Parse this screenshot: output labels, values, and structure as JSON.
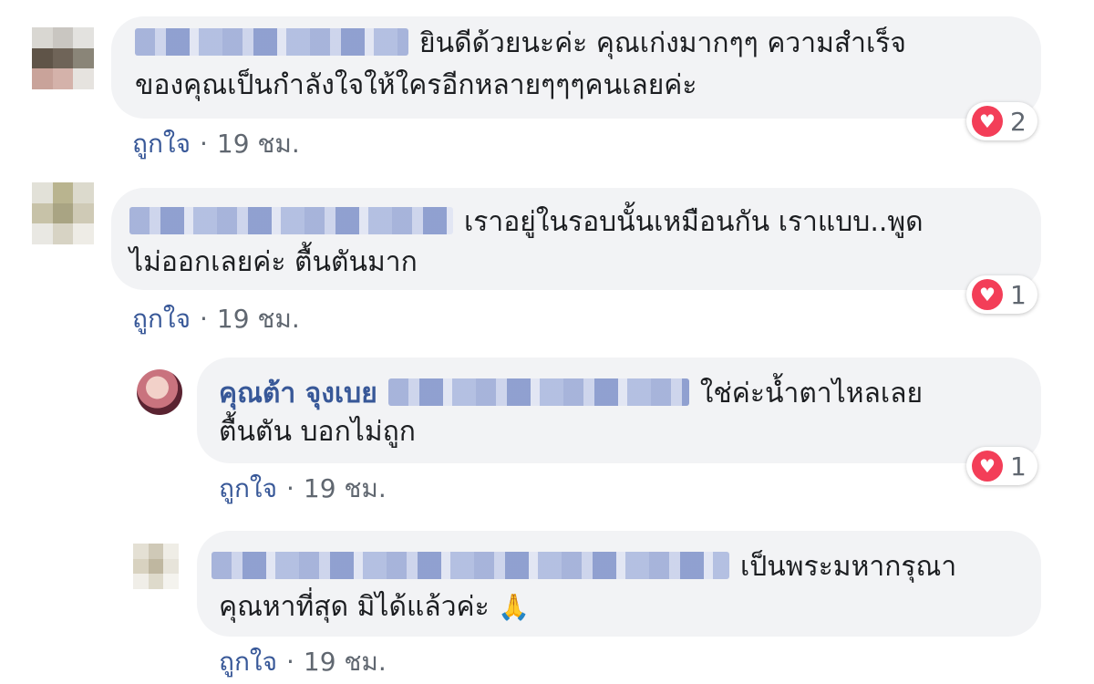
{
  "comments": [
    {
      "text": "ยินดีด้วยนะค่ะ คุณเก่งมากๆๆ ความสำเร็จ",
      "text2": "ของคุณเป็นกำลังใจให้ใครอีกหลายๆๆๆคนเลยค่ะ",
      "like_label": "ถูกใจ",
      "sep": "·",
      "time": "19 ชม.",
      "reactions": "2",
      "avatar_colors": [
        "#d9d7d2",
        "#c9c6c1",
        "#e3e2df",
        "#5f5448",
        "#6f6458",
        "#8a8578",
        "#c9a39a",
        "#d4b2aa",
        "#e6e3df"
      ]
    },
    {
      "text": "เราอยู่ในรอบนั้นเหมือนกัน เราแบบ..พูด",
      "text2": "ไม่ออกเลยค่ะ ตื้นตันมาก",
      "like_label": "ถูกใจ",
      "sep": "·",
      "time": "19 ชม.",
      "reactions": "1",
      "avatar_colors": [
        "#e2e1d8",
        "#b9b48f",
        "#dcdacd",
        "#c7c2a8",
        "#a9a483",
        "#cfcab6",
        "#e9e8e3",
        "#d7d3c4",
        "#eeece6"
      ]
    },
    {
      "author": "คุณต้า จุงเบย",
      "text": "ใช่ค่ะน้ำตาไหลเลย",
      "text2": "ตื้นตัน บอกไม่ถูก",
      "like_label": "ถูกใจ",
      "sep": "·",
      "time": "19 ชม.",
      "reactions": "1"
    },
    {
      "text": "เป็นพระมหากรุณา",
      "text2": "คุณหาที่สุด มิได้แล้วค่ะ",
      "like_label": "ถูกใจ",
      "sep": "·",
      "time": "19 ชม.",
      "avatar_colors": [
        "#e4e0d4",
        "#cfc9b7",
        "#efede6",
        "#d8d2c0",
        "#bfb7a0",
        "#e7e4da",
        "#f0eee8",
        "#dedacb",
        "#f4f3ee"
      ]
    }
  ],
  "colors": {
    "bubble_bg": "#f2f3f5",
    "link": "#385898",
    "meta": "#606770",
    "heart": "#f33e58"
  },
  "icons": [
    "heart-reaction-icon",
    "folded-hands-emoji"
  ]
}
